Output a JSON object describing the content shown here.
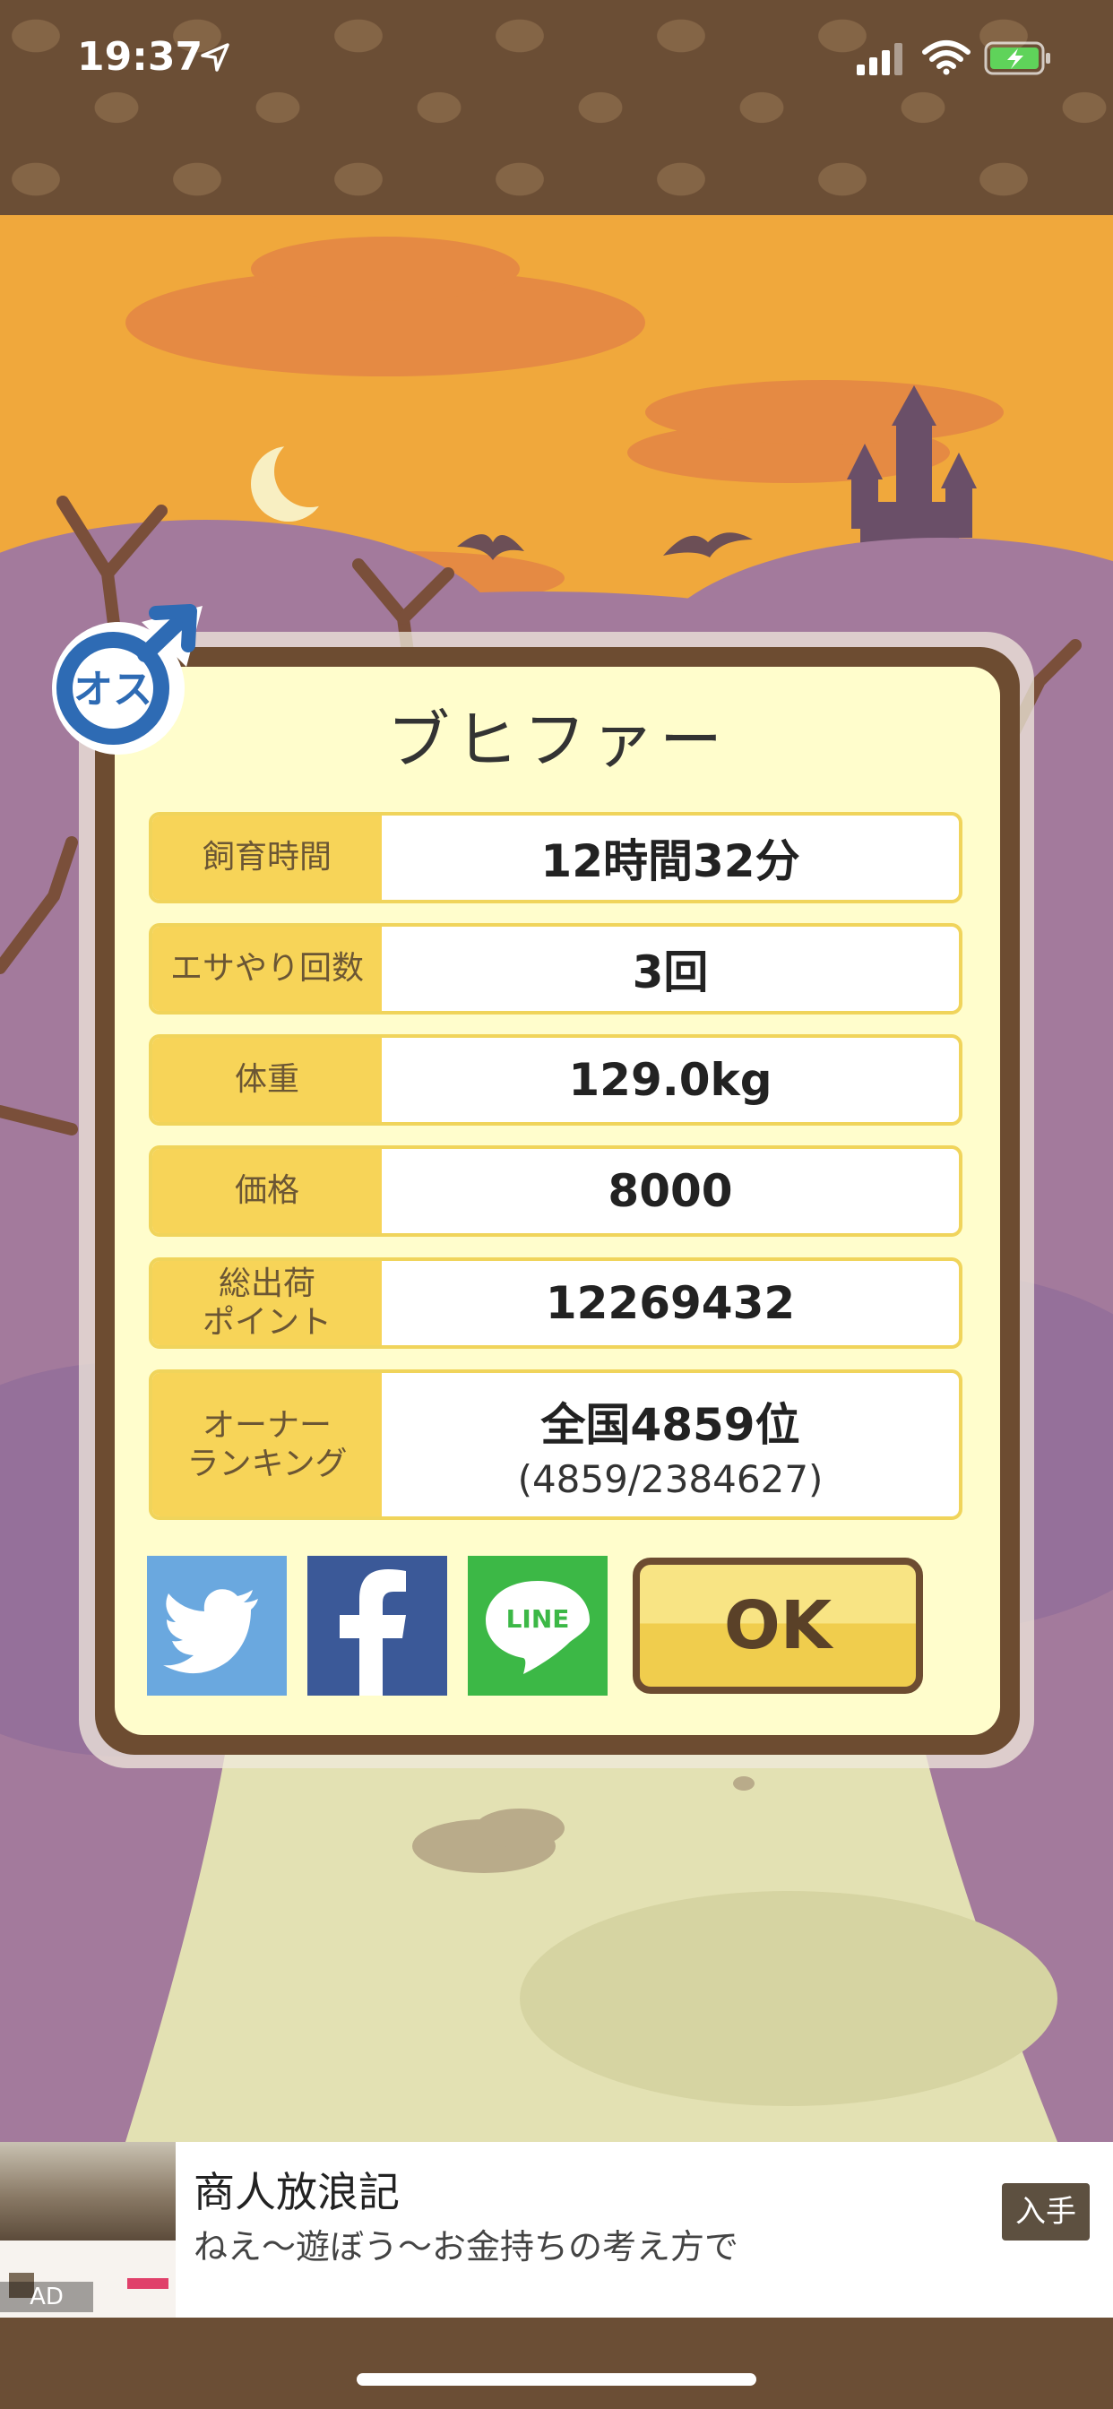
{
  "status_bar": {
    "time": "19:37"
  },
  "dialog": {
    "pet_name": "ブヒファー",
    "stats": [
      {
        "label": "飼育時間",
        "value": "12時間32分"
      },
      {
        "label": "エサやり回数",
        "value": "3回"
      },
      {
        "label": "体重",
        "value": "129.0kg"
      },
      {
        "label": "価格",
        "value": "8000"
      },
      {
        "label": "総出荷\nポイント",
        "value": "12269432"
      },
      {
        "label": "オーナー\nランキング",
        "value": "全国4859位",
        "sub": "(4859/2384627)"
      }
    ],
    "gender_badge": "オス",
    "share": {
      "line_label": "LINE"
    },
    "ok_label": "OK"
  },
  "ad": {
    "title": "商人放浪記",
    "description": "ねえ〜遊ぼう〜お金持ちの考え方で",
    "cta_label": "入手",
    "tag": "AD"
  },
  "icons": [
    "location-arrow-icon",
    "signal-icon",
    "wifi-icon",
    "battery-charging-icon",
    "twitter-icon",
    "facebook-icon",
    "line-icon",
    "male-symbol-icon"
  ],
  "colors": {
    "accent": "#f7d458",
    "frame": "#6d4c31",
    "panel": "#fffdcc"
  }
}
